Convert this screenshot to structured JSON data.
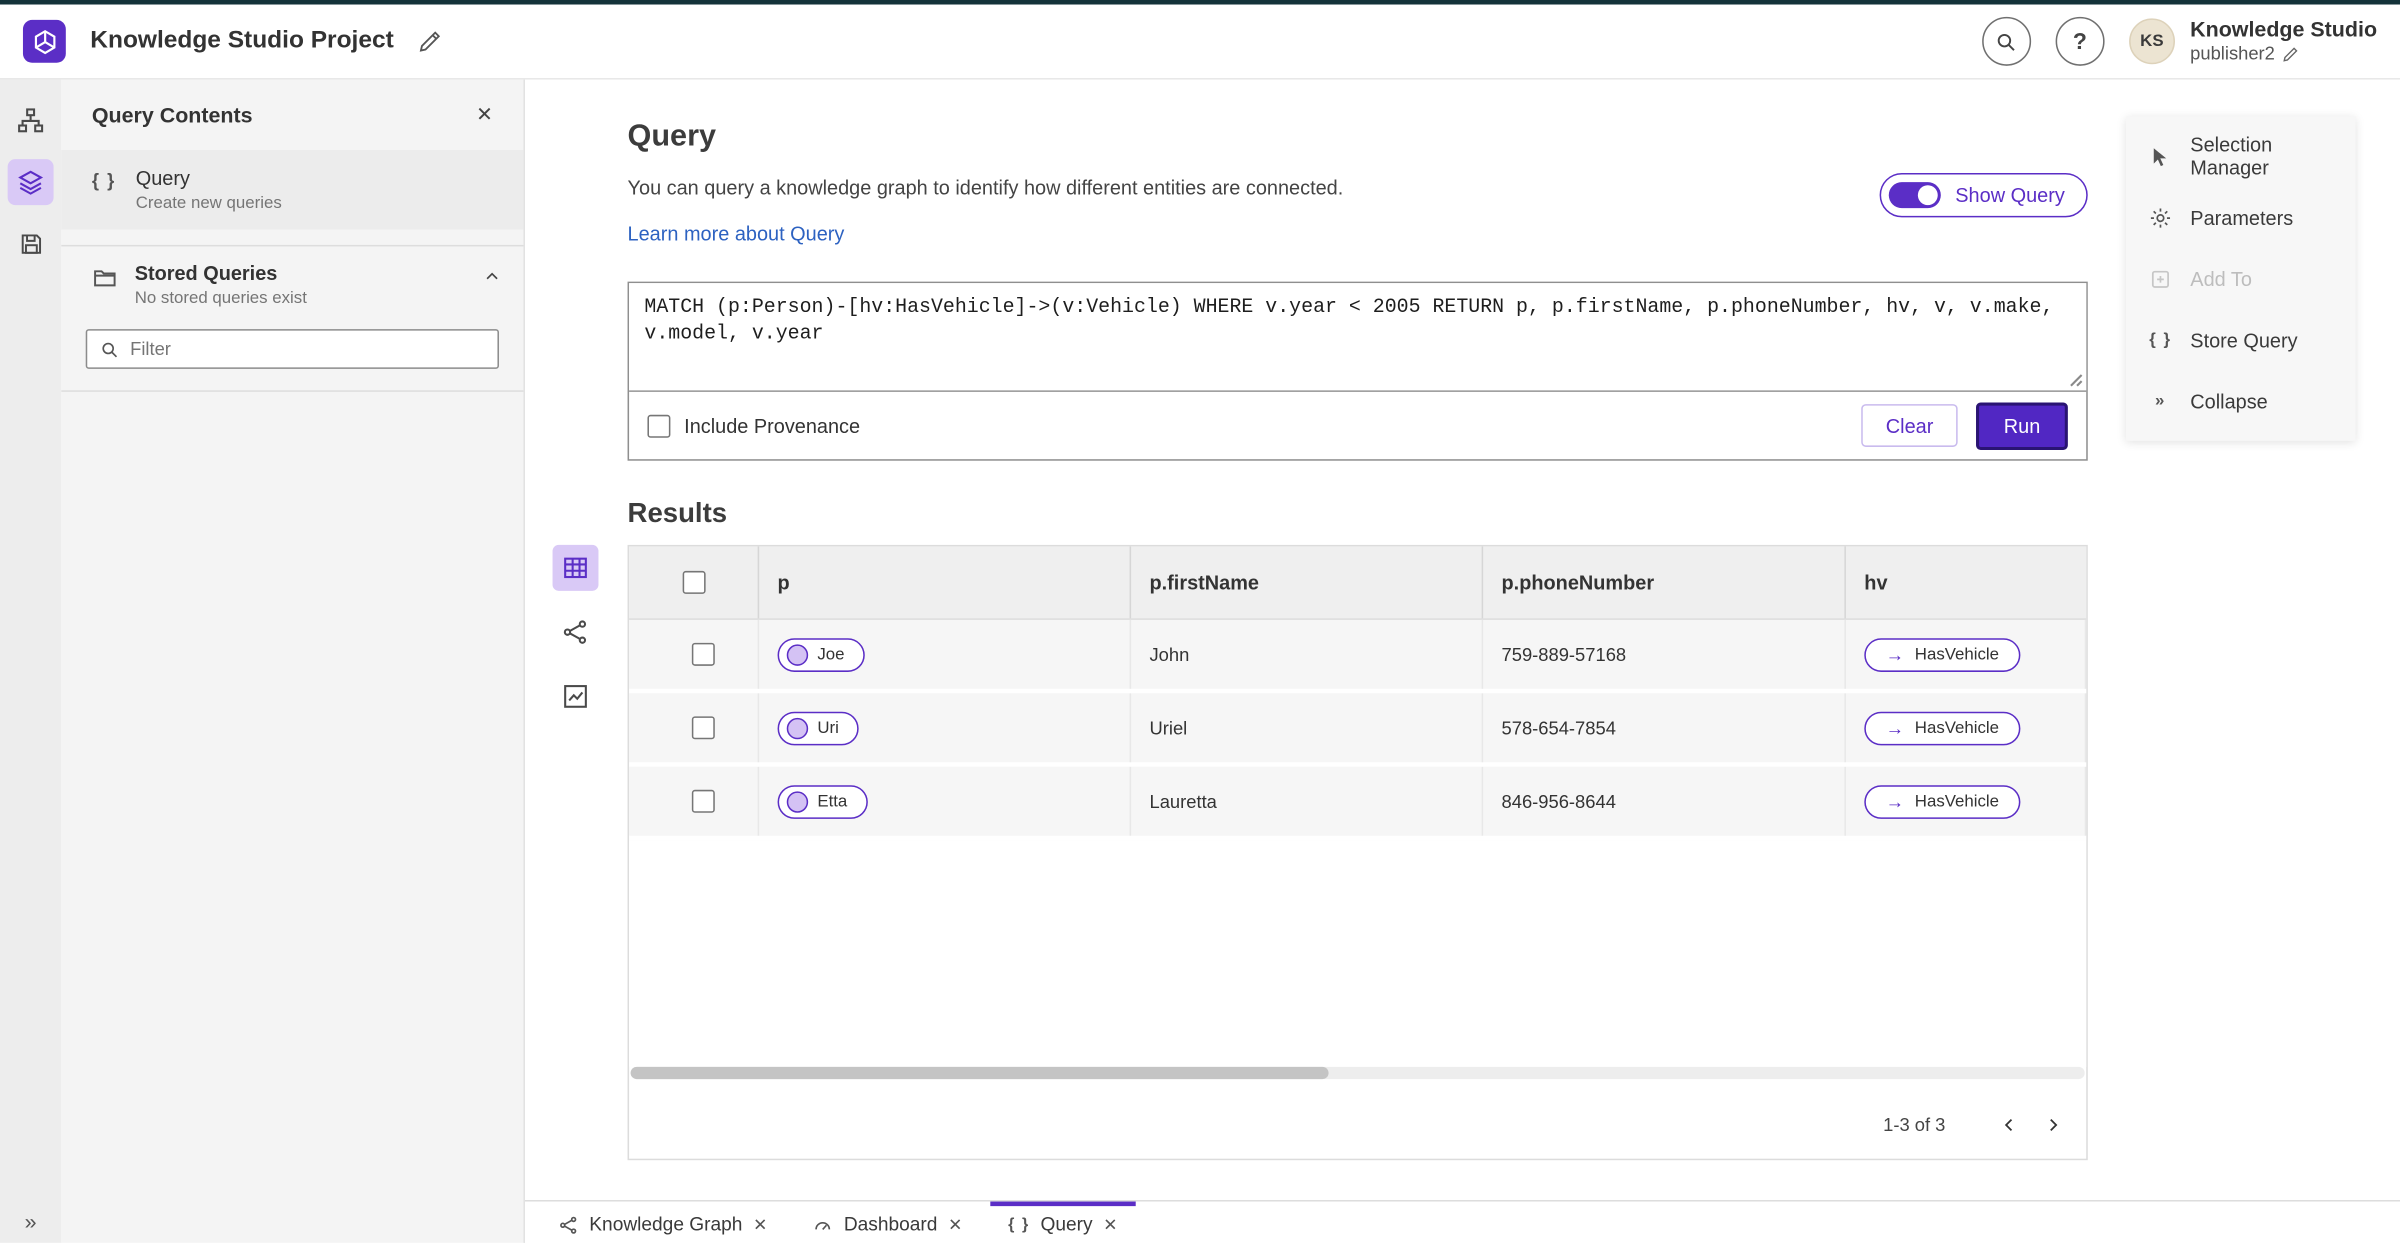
{
  "colors": {
    "accent": "#5b2ec6",
    "run_button": "#5127c3",
    "link_blue": "#2d62c1"
  },
  "icons": {
    "braces": "{ }",
    "expand": "»",
    "arrow_right": "→",
    "close": "✕",
    "help": "?"
  },
  "header": {
    "app_title": "Knowledge Studio Project",
    "user_initials": "KS",
    "user_name": "Knowledge Studio",
    "user_role": "publisher2"
  },
  "sidebar": {
    "title": "Query Contents",
    "query_item": {
      "label": "Query",
      "sublabel": "Create new queries"
    },
    "stored_queries": {
      "label": "Stored Queries",
      "sublabel": "No stored queries exist"
    },
    "filter_placeholder": "Filter"
  },
  "query_panel": {
    "title": "Query",
    "description": "You can query a knowledge graph to identify how different entities are connected.",
    "learn_more": "Learn more about Query",
    "show_query": "Show Query",
    "query_text": "MATCH (p:Person)-[hv:HasVehicle]->(v:Vehicle) WHERE v.year < 2005 RETURN p, p.firstName, p.phoneNumber, hv, v, v.make, v.model, v.year",
    "include_provenance": "Include Provenance",
    "clear": "Clear",
    "run": "Run"
  },
  "results": {
    "title": "Results",
    "columns": [
      "p",
      "p.firstName",
      "p.phoneNumber",
      "hv"
    ],
    "rows": [
      {
        "p": "Joe",
        "firstName": "John",
        "phoneNumber": "759-889-57168",
        "hv": "HasVehicle"
      },
      {
        "p": "Uri",
        "firstName": "Uriel",
        "phoneNumber": "578-654-7854",
        "hv": "HasVehicle"
      },
      {
        "p": "Etta",
        "firstName": "Lauretta",
        "phoneNumber": "846-956-8644",
        "hv": "HasVehicle"
      }
    ],
    "pagination": "1-3 of 3"
  },
  "context_menu": {
    "items": [
      "Selection Manager",
      "Parameters",
      "Add To",
      "Store Query",
      "Collapse"
    ]
  },
  "tabs": [
    {
      "label": "Knowledge Graph"
    },
    {
      "label": "Dashboard"
    },
    {
      "label": "Query"
    }
  ]
}
